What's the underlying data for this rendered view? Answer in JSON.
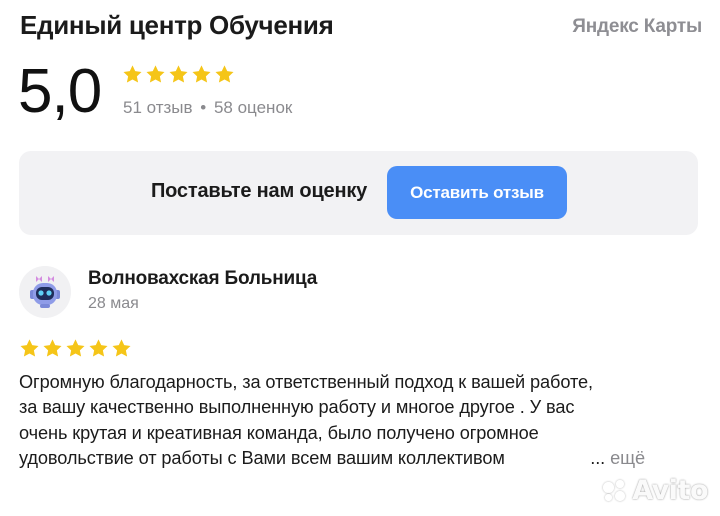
{
  "header": {
    "title": "Единый центр Обучения",
    "brand": "Яндекс Карты"
  },
  "rating": {
    "value": "5,0",
    "stars": 5,
    "reviews_count": "51 отзыв",
    "separator": "•",
    "ratings_count": "58 оценок"
  },
  "cta": {
    "prompt": "Поставьте нам оценку",
    "button_label": "Оставить отзыв",
    "button_color": "#4a8ef6"
  },
  "review": {
    "author": "Волновахская Больница",
    "date": "28 мая",
    "stars": 5,
    "avatar_icon": "robot-icon",
    "text_lines": [
      "Огромную благодарность, за ответственный подход к вашей работе,",
      "за вашу качественно выполненную работу и многое другое . У вас",
      "очень крутая и креативная команда, было получено огромное",
      "удовольствие от работы с Вами всем вашим коллективом"
    ],
    "more_ellipsis": "...",
    "more_label": "ещё"
  },
  "colors": {
    "star": "#f5c518",
    "cta_background": "#f2f2f4",
    "muted_text": "#8a8a8e"
  },
  "watermark": {
    "text": "Avito"
  }
}
